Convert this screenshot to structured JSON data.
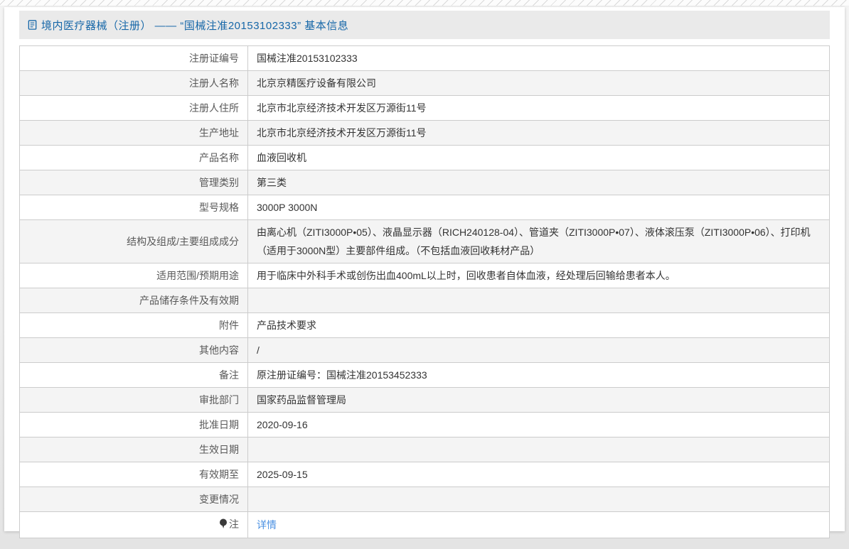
{
  "header": {
    "title": "境内医疗器械（注册） —— “国械注准20153102333” 基本信息",
    "icon": "document-icon"
  },
  "colors": {
    "title_blue": "#1667a8",
    "link_blue": "#4a90e2",
    "titlebar_bg": "#eaeaea",
    "row_alt_bg": "#f4f4f4",
    "table_border": "#cccccc",
    "label_text": "#595959",
    "value_text": "#333333"
  },
  "table": {
    "rows": [
      {
        "label": "注册证编号",
        "value": "国械注准20153102333"
      },
      {
        "label": "注册人名称",
        "value": "北京京精医疗设备有限公司"
      },
      {
        "label": "注册人住所",
        "value": "北京市北京经济技术开发区万源街11号"
      },
      {
        "label": "生产地址",
        "value": "北京市北京经济技术开发区万源街11号"
      },
      {
        "label": "产品名称",
        "value": "血液回收机"
      },
      {
        "label": "管理类别",
        "value": "第三类"
      },
      {
        "label": "型号规格",
        "value": "3000P 3000N"
      },
      {
        "label": "结构及组成/主要组成成分",
        "value": "由离心机（ZITI3000P•05）、液晶显示器（RICH240128-04）、管道夹（ZITI3000P•07）、液体滚压泵（ZITI3000P•06）、打印机（适用于3000N型）主要部件组成。（不包括血液回收耗材产品）"
      },
      {
        "label": "适用范围/预期用途",
        "value": "用于临床中外科手术或创伤出血400mL以上时，回收患者自体血液，经处理后回输给患者本人。"
      },
      {
        "label": "产品储存条件及有效期",
        "value": ""
      },
      {
        "label": "附件",
        "value": "产品技术要求"
      },
      {
        "label": "其他内容",
        "value": "/"
      },
      {
        "label": "备注",
        "value": "原注册证编号：国械注准20153452333"
      },
      {
        "label": "审批部门",
        "value": "国家药品监督管理局"
      },
      {
        "label": "批准日期",
        "value": "2020-09-16"
      },
      {
        "label": "生效日期",
        "value": ""
      },
      {
        "label": "有效期至",
        "value": "2025-09-15"
      },
      {
        "label": "变更情况",
        "value": ""
      },
      {
        "label": "注",
        "value": "详情",
        "label_icon": "note-icon",
        "value_is_link": true
      }
    ]
  }
}
